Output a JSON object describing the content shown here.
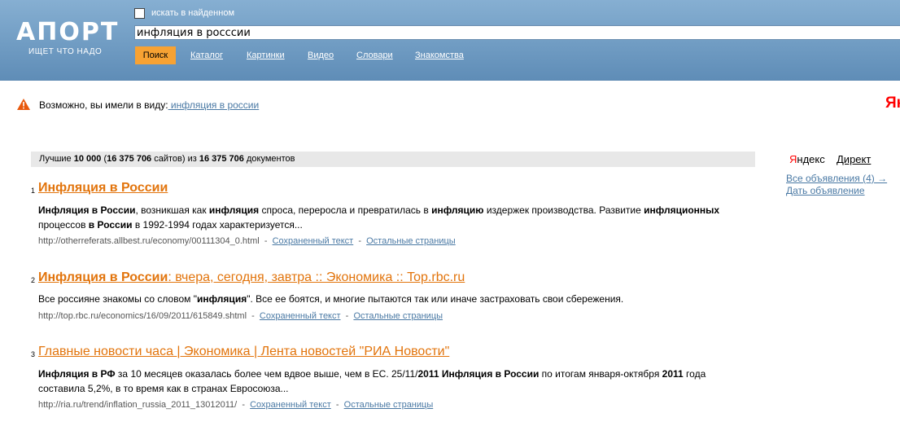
{
  "header": {
    "logo": "АПОРТ",
    "slogan": "ИЩЕТ ЧТО НАДО",
    "search_in_found_label": "искать в найденном",
    "search_query": "инфляция в росссии",
    "search_button": "Поиск",
    "nav": [
      "Каталог",
      "Картинки",
      "Видео",
      "Словари",
      "Знакомства"
    ]
  },
  "suggestion": {
    "prefix": "Возможно, вы имели в виду:",
    "link": " инфляция в россии",
    "yandex_cut": "Ян"
  },
  "stats": {
    "best": "Лучшие",
    "count": "10 000",
    "sites_open": " (",
    "sites": "16 375 706",
    "sites_label": " сайтов)  из ",
    "total": "16 375 706",
    "docs_label": " документов"
  },
  "results": [
    {
      "num": "1",
      "title_bold": "Инфляция в России",
      "title_rest": "",
      "snippet_html": "<b>Инфляция в России</b>, возникшая как <b>инфляция</b> спроса, переросла и превратилась в <b>инфляцию</b> издержек производства. Развитие <b>инфляционных</b> процессов <b>в России</b> в 1992-1994 годах характеризуется...",
      "url": "http://otherreferats.allbest.ru/economy/00111304_0.html",
      "cached": "Сохраненный текст",
      "other": "Остальные страницы"
    },
    {
      "num": "2",
      "title_bold": "Инфляция в России",
      "title_rest": ": вчера, сегодня, завтра :: Экономика :: Top.rbc.ru",
      "snippet_html": "Все россияне знакомы со словом \"<b>инфляция</b>\". Все ее боятся, и многие пытаются так или иначе застраховать свои сбережения.",
      "url": "http://top.rbc.ru/economics/16/09/2011/615849.shtml",
      "cached": "Сохраненный текст",
      "other": "Остальные страницы"
    },
    {
      "num": "3",
      "title_bold": "",
      "title_rest": "Главные новости часа | Экономика | Лента новостей \"РИА Новости\"",
      "snippet_html": "<b>Инфляция в РФ</b> за 10 месяцев оказалась более чем вдвое выше, чем в ЕС. 25/11/<b>2011</b> <b>Инфляция в России</b> по итогам января-октября <b>2011</b> года составила 5,2%, в то время как в странах Евросоюза...",
      "url": "http://ria.ru/trend/inflation_russia_2011_13012011/",
      "cached": "Сохраненный текст",
      "other": "Остальные страницы"
    }
  ],
  "ads": {
    "yandex_first": "Я",
    "yandex_rest": "ндекс",
    "direct": "Директ",
    "all_ads": "Все объявления (4) →",
    "give_ad": "Дать объявление"
  },
  "colors": {
    "header_top": "#86afd2",
    "header_bottom": "#5f8db7",
    "button": "#f7a233",
    "title_link": "#e2740c",
    "link": "#4a79a4"
  }
}
